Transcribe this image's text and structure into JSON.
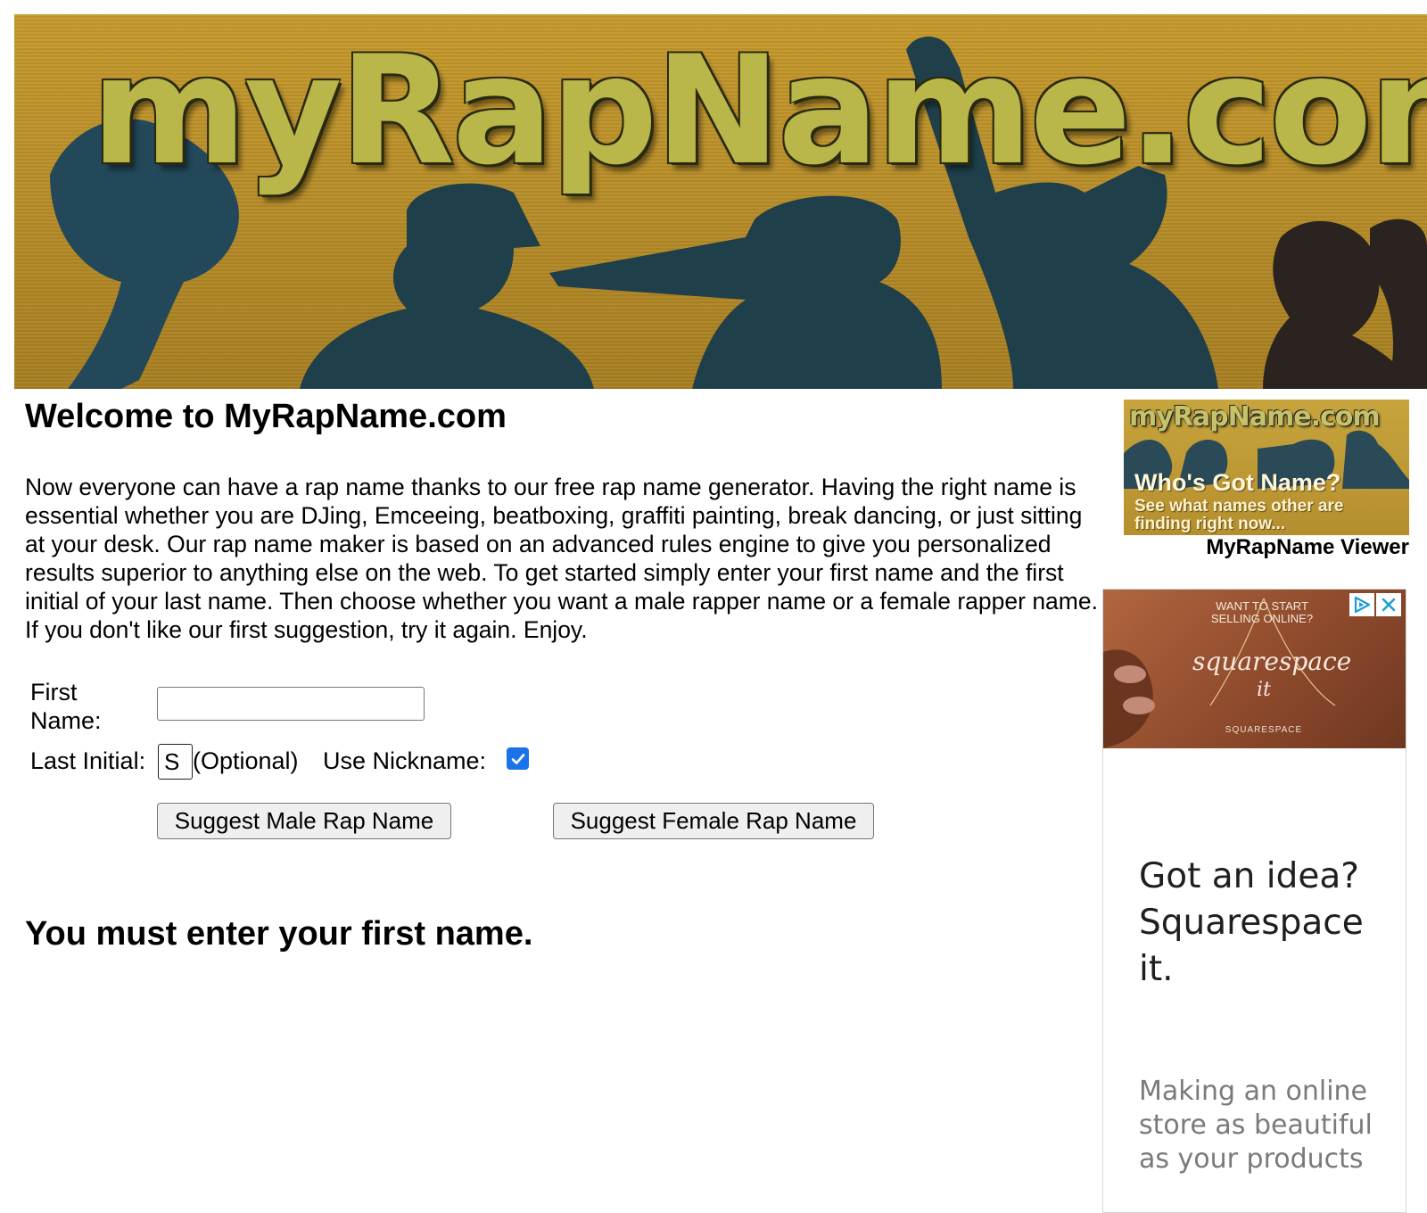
{
  "banner": {
    "title": "myRapName.com"
  },
  "main": {
    "welcome_title": "Welcome to MyRapName.com",
    "intro": "Now everyone can have a rap name thanks to our free rap name generator. Having the right name is essential whether you are DJing, Emceeing, beatboxing, graffiti painting, break dancing, or just sitting at your desk. Our rap name maker is based on an advanced rules engine to give you personalized results superior to anything else on the web. To get started simply enter your first name and the first initial of your last name. Then choose whether you want a male rapper name or a female rapper name. If you don't like our first suggestion, try it again. Enjoy."
  },
  "form": {
    "first_name_label": "First Name:",
    "first_name_value": "",
    "last_initial_label": "Last Initial:",
    "last_initial_value": "S",
    "optional_label": "(Optional)",
    "nickname_label": "Use Nickname:",
    "nickname_checked": true,
    "male_button": "Suggest Male Rap Name",
    "female_button": "Suggest Female Rap Name"
  },
  "error_message": "You must enter your first name.",
  "sidebar": {
    "viewer_thumb": {
      "logo": "myRapName.com",
      "heading": "Who's Got Name?",
      "subtext": "See what names other are finding right now..."
    },
    "viewer_label": "MyRapName Viewer"
  },
  "ad": {
    "image_hook": "WANT TO START SELLING ONLINE?",
    "image_brand": "squarespace",
    "image_it": "it",
    "image_brand_small": "SQUARESPACE",
    "headline": "Got an idea? Squarespace it.",
    "body": "Making an online store as beautiful as your products",
    "choices_icon_color": "#1a9ad6",
    "close_icon_color": "#1a9ad6"
  },
  "colors": {
    "banner_gold": "#b98f2a",
    "silhouette": "#24444f",
    "checkbox_blue": "#1a73e8"
  }
}
